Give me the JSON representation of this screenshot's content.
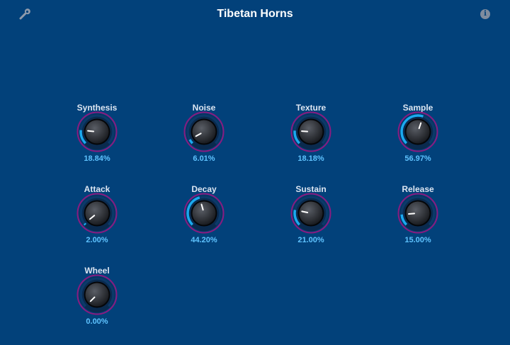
{
  "header": {
    "title": "Tibetan Horns",
    "settings_icon": "wrench-icon",
    "info_icon": "info-icon",
    "info_glyph": "i"
  },
  "colors": {
    "background": "#02417a",
    "value_text": "#5fc3ff",
    "arc_fill": "#1aa9ef",
    "arc_outer": "#8a1b7f"
  },
  "params": [
    {
      "id": "synthesis",
      "label": "Synthesis",
      "value": "18.84%",
      "fraction": 0.1884
    },
    {
      "id": "noise",
      "label": "Noise",
      "value": "6.01%",
      "fraction": 0.0601
    },
    {
      "id": "texture",
      "label": "Texture",
      "value": "18.18%",
      "fraction": 0.1818
    },
    {
      "id": "sample",
      "label": "Sample",
      "value": "56.97%",
      "fraction": 0.5697
    },
    {
      "id": "attack",
      "label": "Attack",
      "value": "2.00%",
      "fraction": 0.02
    },
    {
      "id": "decay",
      "label": "Decay",
      "value": "44.20%",
      "fraction": 0.442
    },
    {
      "id": "sustain",
      "label": "Sustain",
      "value": "21.00%",
      "fraction": 0.21
    },
    {
      "id": "release",
      "label": "Release",
      "value": "15.00%",
      "fraction": 0.15
    },
    {
      "id": "wheel",
      "label": "Wheel",
      "value": "0.00%",
      "fraction": 0.0
    }
  ]
}
